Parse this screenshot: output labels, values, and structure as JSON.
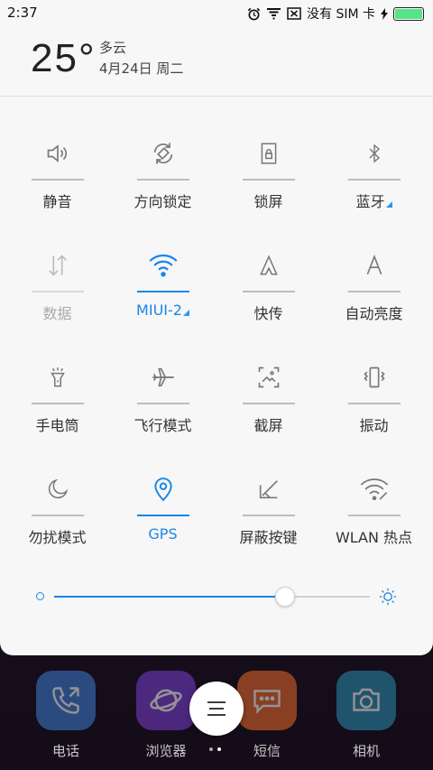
{
  "status": {
    "time": "2:37",
    "no_sim_text": "没有 SIM 卡",
    "battery_color": "#57e389"
  },
  "weather": {
    "temperature": "25°",
    "condition": "多云",
    "date": "4月24日 周二"
  },
  "tiles": [
    {
      "label": "静音",
      "icon": "volume-icon",
      "active": false
    },
    {
      "label": "方向锁定",
      "icon": "rotation-lock-icon",
      "active": false
    },
    {
      "label": "锁屏",
      "icon": "lock-screen-icon",
      "active": false
    },
    {
      "label": "蓝牙",
      "icon": "bluetooth-icon",
      "active": false
    },
    {
      "label": "数据",
      "icon": "data-arrows-icon",
      "active": false,
      "disabled": true
    },
    {
      "label": "MIUI-2",
      "icon": "wifi-icon",
      "active": true
    },
    {
      "label": "快传",
      "icon": "quick-transfer-icon",
      "active": false
    },
    {
      "label": "自动亮度",
      "icon": "auto-brightness-icon",
      "active": false
    },
    {
      "label": "手电筒",
      "icon": "flashlight-icon",
      "active": false
    },
    {
      "label": "飞行模式",
      "icon": "airplane-icon",
      "active": false
    },
    {
      "label": "截屏",
      "icon": "screenshot-icon",
      "active": false
    },
    {
      "label": "振动",
      "icon": "vibrate-icon",
      "active": false
    },
    {
      "label": "勿扰模式",
      "icon": "moon-icon",
      "active": false
    },
    {
      "label": "GPS",
      "icon": "location-pin-icon",
      "active": true
    },
    {
      "label": "屏蔽按键",
      "icon": "block-keys-icon",
      "active": false
    },
    {
      "label": "WLAN 热点",
      "icon": "hotspot-icon",
      "active": false
    }
  ],
  "brightness": {
    "level": 0.73
  },
  "accent_color": "#1a86e8",
  "dock": [
    {
      "label": "电话",
      "icon": "phone-icon",
      "color": "#3d7fd4"
    },
    {
      "label": "浏览器",
      "icon": "browser-icon",
      "color": "#7a3fd0"
    },
    {
      "label": "短信",
      "icon": "sms-icon",
      "color": "#e86a2a"
    },
    {
      "label": "相机",
      "icon": "camera-icon",
      "color": "#2a8fb0"
    }
  ]
}
